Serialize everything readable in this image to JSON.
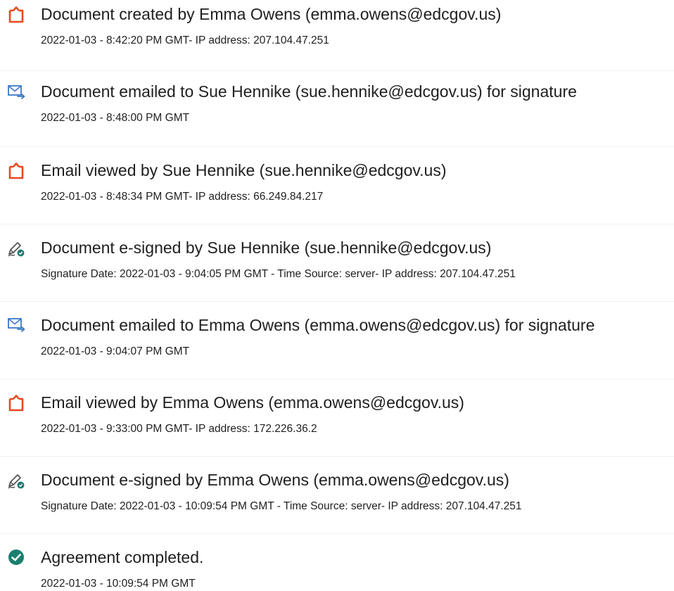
{
  "events": [
    {
      "icon": "document-created-icon",
      "title": "Document created by Emma Owens (emma.owens@edcgov.us)",
      "detail": "2022-01-03 - 8:42:20 PM GMT- IP address: 207.104.47.251"
    },
    {
      "icon": "email-sent-icon",
      "title": "Document emailed to Sue Hennike (sue.hennike@edcgov.us) for signature",
      "detail": "2022-01-03 - 8:48:00 PM GMT"
    },
    {
      "icon": "document-viewed-icon",
      "title": "Email viewed by Sue Hennike (sue.hennike@edcgov.us)",
      "detail": "2022-01-03 - 8:48:34 PM GMT- IP address: 66.249.84.217"
    },
    {
      "icon": "e-sign-pen-icon",
      "title": "Document e-signed by Sue Hennike (sue.hennike@edcgov.us)",
      "detail": "Signature Date: 2022-01-03 - 9:04:05 PM GMT - Time Source: server- IP address: 207.104.47.251"
    },
    {
      "icon": "email-sent-icon",
      "title": "Document emailed to Emma Owens (emma.owens@edcgov.us) for signature",
      "detail": "2022-01-03 - 9:04:07 PM GMT"
    },
    {
      "icon": "document-viewed-icon",
      "title": "Email viewed by Emma Owens (emma.owens@edcgov.us)",
      "detail": "2022-01-03 - 9:33:00 PM GMT- IP address: 172.226.36.2"
    },
    {
      "icon": "e-sign-pen-icon",
      "title": "Document e-signed by Emma Owens (emma.owens@edcgov.us)",
      "detail": "Signature Date: 2022-01-03 - 10:09:54 PM GMT - Time Source: server- IP address: 207.104.47.251"
    },
    {
      "icon": "checkmark-circle-icon",
      "title": "Agreement completed.",
      "detail": "2022-01-03 - 10:09:54 PM GMT"
    }
  ],
  "colors": {
    "document_icon": "#e8481f",
    "email_icon": "#3a78c8",
    "esign_icon": "#555555",
    "esign_badge": "#1f7a73",
    "complete_icon": "#1a7f6e",
    "text": "#1f1f1f"
  }
}
